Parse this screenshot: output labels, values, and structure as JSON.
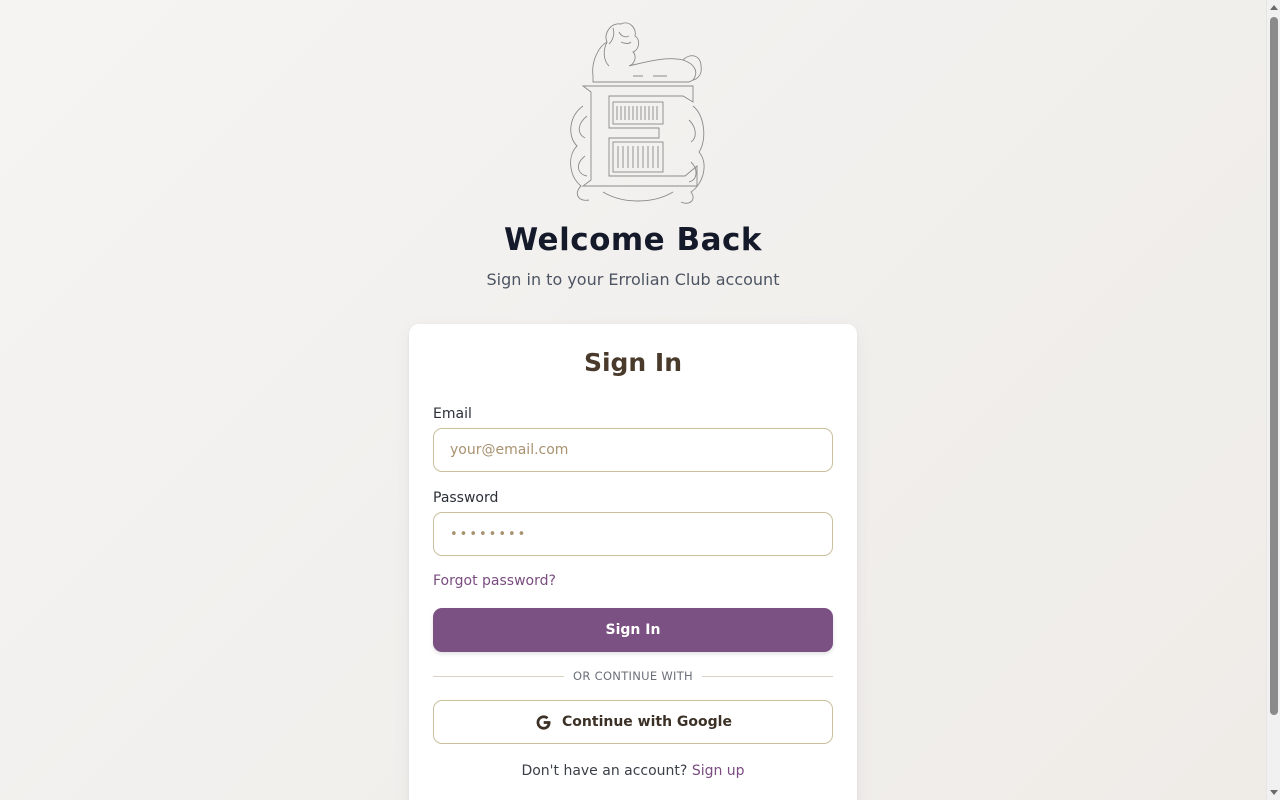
{
  "hero": {
    "title": "Welcome Back",
    "subtitle": "Sign in to your Errolian Club account"
  },
  "logo": {
    "icon": "lion-monogram-E-logo"
  },
  "form": {
    "title": "Sign In",
    "email": {
      "label": "Email",
      "placeholder": "your@email.com",
      "value": ""
    },
    "password": {
      "label": "Password",
      "value": "••••••••"
    },
    "forgot_label": "Forgot password?",
    "submit_label": "Sign In",
    "divider_text": "OR CONTINUE WITH",
    "google_label": "Continue with Google",
    "google_icon": "google-g-icon",
    "signup_prompt": "Don't have an account?",
    "signup_link": "Sign up"
  },
  "colors": {
    "accent": "#7b5082",
    "link": "#7a4c80",
    "input_border": "#cbbf9f",
    "card_title": "#4a3a2c"
  }
}
